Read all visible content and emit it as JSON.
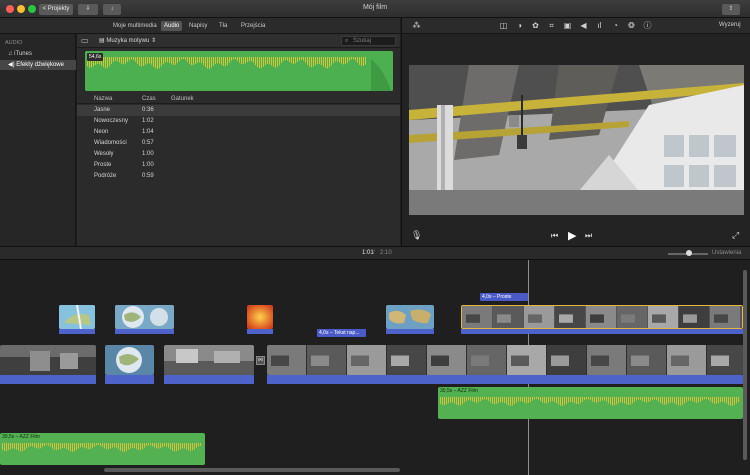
{
  "window": {
    "title": "Mój film",
    "back_button": "< Projekty"
  },
  "tabs": [
    {
      "label": "Moje multimedia"
    },
    {
      "label": "Audio"
    },
    {
      "label": "Napisy"
    },
    {
      "label": "Tła"
    },
    {
      "label": "Przejścia"
    }
  ],
  "sidebar": {
    "heading": "AUDIO",
    "items": [
      {
        "label": "iTunes"
      },
      {
        "label": "Efekty dźwiękowe"
      }
    ]
  },
  "browser": {
    "source_dropdown": "Muzyka motywu",
    "search_placeholder": "Szukaj",
    "waveform_badge": "54,6s",
    "columns": {
      "name": "Nazwa",
      "time": "Czas",
      "genre": "Gatunek"
    },
    "rows": [
      {
        "name": "Jasne",
        "time": "0:36"
      },
      {
        "name": "Nowoczesny",
        "time": "1:02"
      },
      {
        "name": "Neon",
        "time": "1:04"
      },
      {
        "name": "Wiadomości",
        "time": "0:57"
      },
      {
        "name": "Wesoły",
        "time": "1:00"
      },
      {
        "name": "Proste",
        "time": "1:00"
      },
      {
        "name": "Podróże",
        "time": "0:59"
      }
    ]
  },
  "viewer": {
    "reset_label": "Wyzeruj"
  },
  "timeline": {
    "current_time": "1:01",
    "total_time": "2:10",
    "settings_label": "Ustawienia",
    "labels": {
      "title_a": "4,0s – Proste",
      "title_b": "4,0s – Tekst nap...",
      "music_a": "30,5s – AZZ Film",
      "music_b": "30,5s – AZZ Film"
    }
  },
  "colors": {
    "accent_audio": "#4caf50",
    "accent_track": "#4d63c9",
    "selection": "#e9b63c"
  }
}
